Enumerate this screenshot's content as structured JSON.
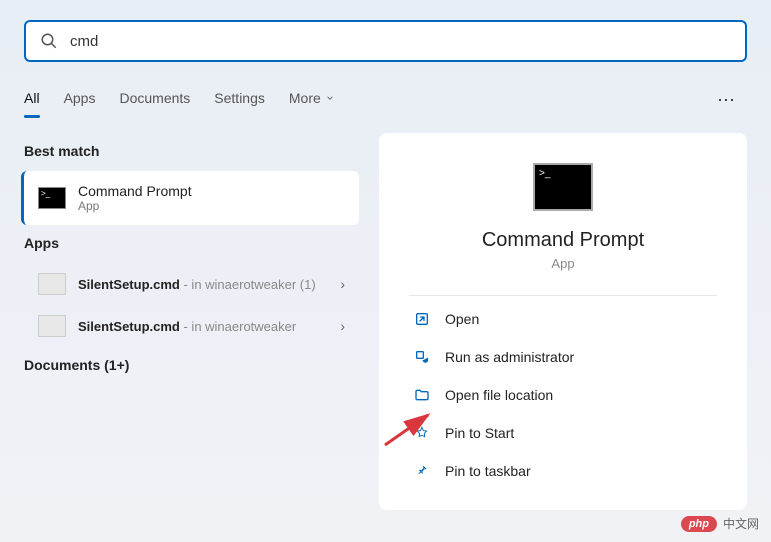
{
  "search": {
    "value": "cmd"
  },
  "tabs": {
    "all": "All",
    "apps": "Apps",
    "documents": "Documents",
    "settings": "Settings",
    "more": "More"
  },
  "sections": {
    "best_match": "Best match",
    "apps": "Apps",
    "documents": "Documents (1+)"
  },
  "best_match": {
    "title": "Command Prompt",
    "subtitle": "App"
  },
  "app_results": [
    {
      "name": "SilentSetup.cmd",
      "location": "- in winaerotweaker (1)"
    },
    {
      "name": "SilentSetup.cmd",
      "location": "- in winaerotweaker"
    }
  ],
  "details": {
    "title": "Command Prompt",
    "subtitle": "App",
    "actions": {
      "open": "Open",
      "run_admin": "Run as administrator",
      "open_location": "Open file location",
      "pin_start": "Pin to Start",
      "pin_taskbar": "Pin to taskbar"
    }
  },
  "watermark": {
    "brand": "php",
    "text": "中文网"
  }
}
